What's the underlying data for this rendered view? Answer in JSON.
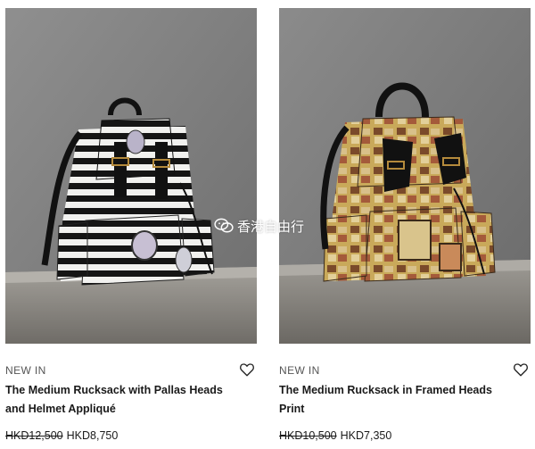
{
  "products": [
    {
      "badge": "NEW IN",
      "title": "The Medium Rucksack with Pallas Heads and Helmet Appliqué",
      "original_price": "HKD12,500",
      "sale_price": "HKD8,750",
      "wishlist_icon": "heart-icon"
    },
    {
      "badge": "NEW IN",
      "title": "The Medium Rucksack in Framed Heads Print",
      "original_price": "HKD10,500",
      "sale_price": "HKD7,350",
      "wishlist_icon": "heart-icon"
    }
  ],
  "watermark": {
    "text": "香港自由行",
    "icon": "wechat-icon"
  },
  "colors": {
    "wall": "#7b7b7b",
    "plinth": "#8a8782",
    "text": "#1a1a1a"
  }
}
